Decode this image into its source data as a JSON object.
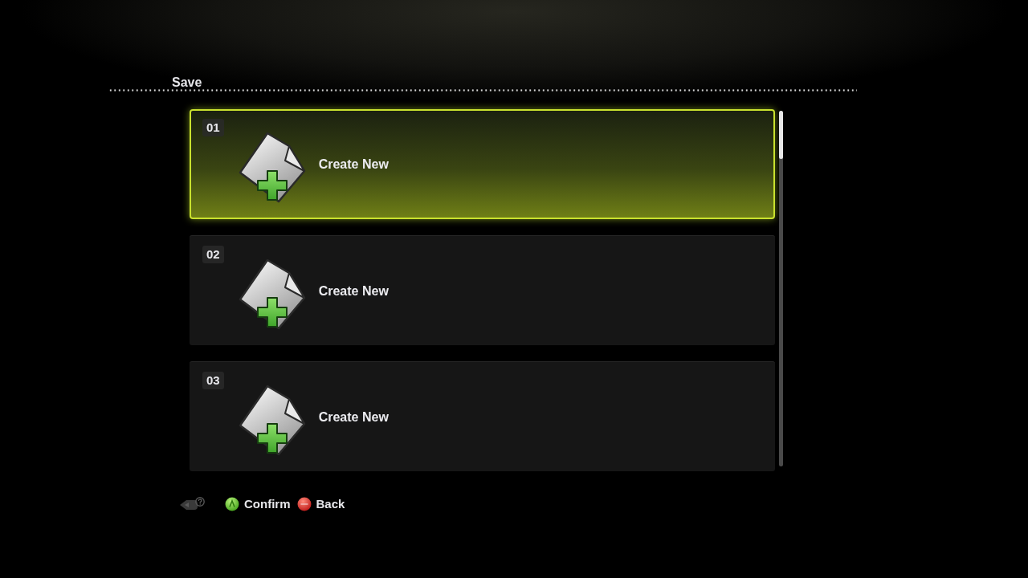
{
  "title": "Save",
  "slots": [
    {
      "number": "01",
      "label": "Create New",
      "selected": true
    },
    {
      "number": "02",
      "label": "Create New",
      "selected": false
    },
    {
      "number": "03",
      "label": "Create New",
      "selected": false
    }
  ],
  "hints": [
    {
      "kind": "confirm",
      "label": "Confirm"
    },
    {
      "kind": "back",
      "label": "Back"
    }
  ]
}
